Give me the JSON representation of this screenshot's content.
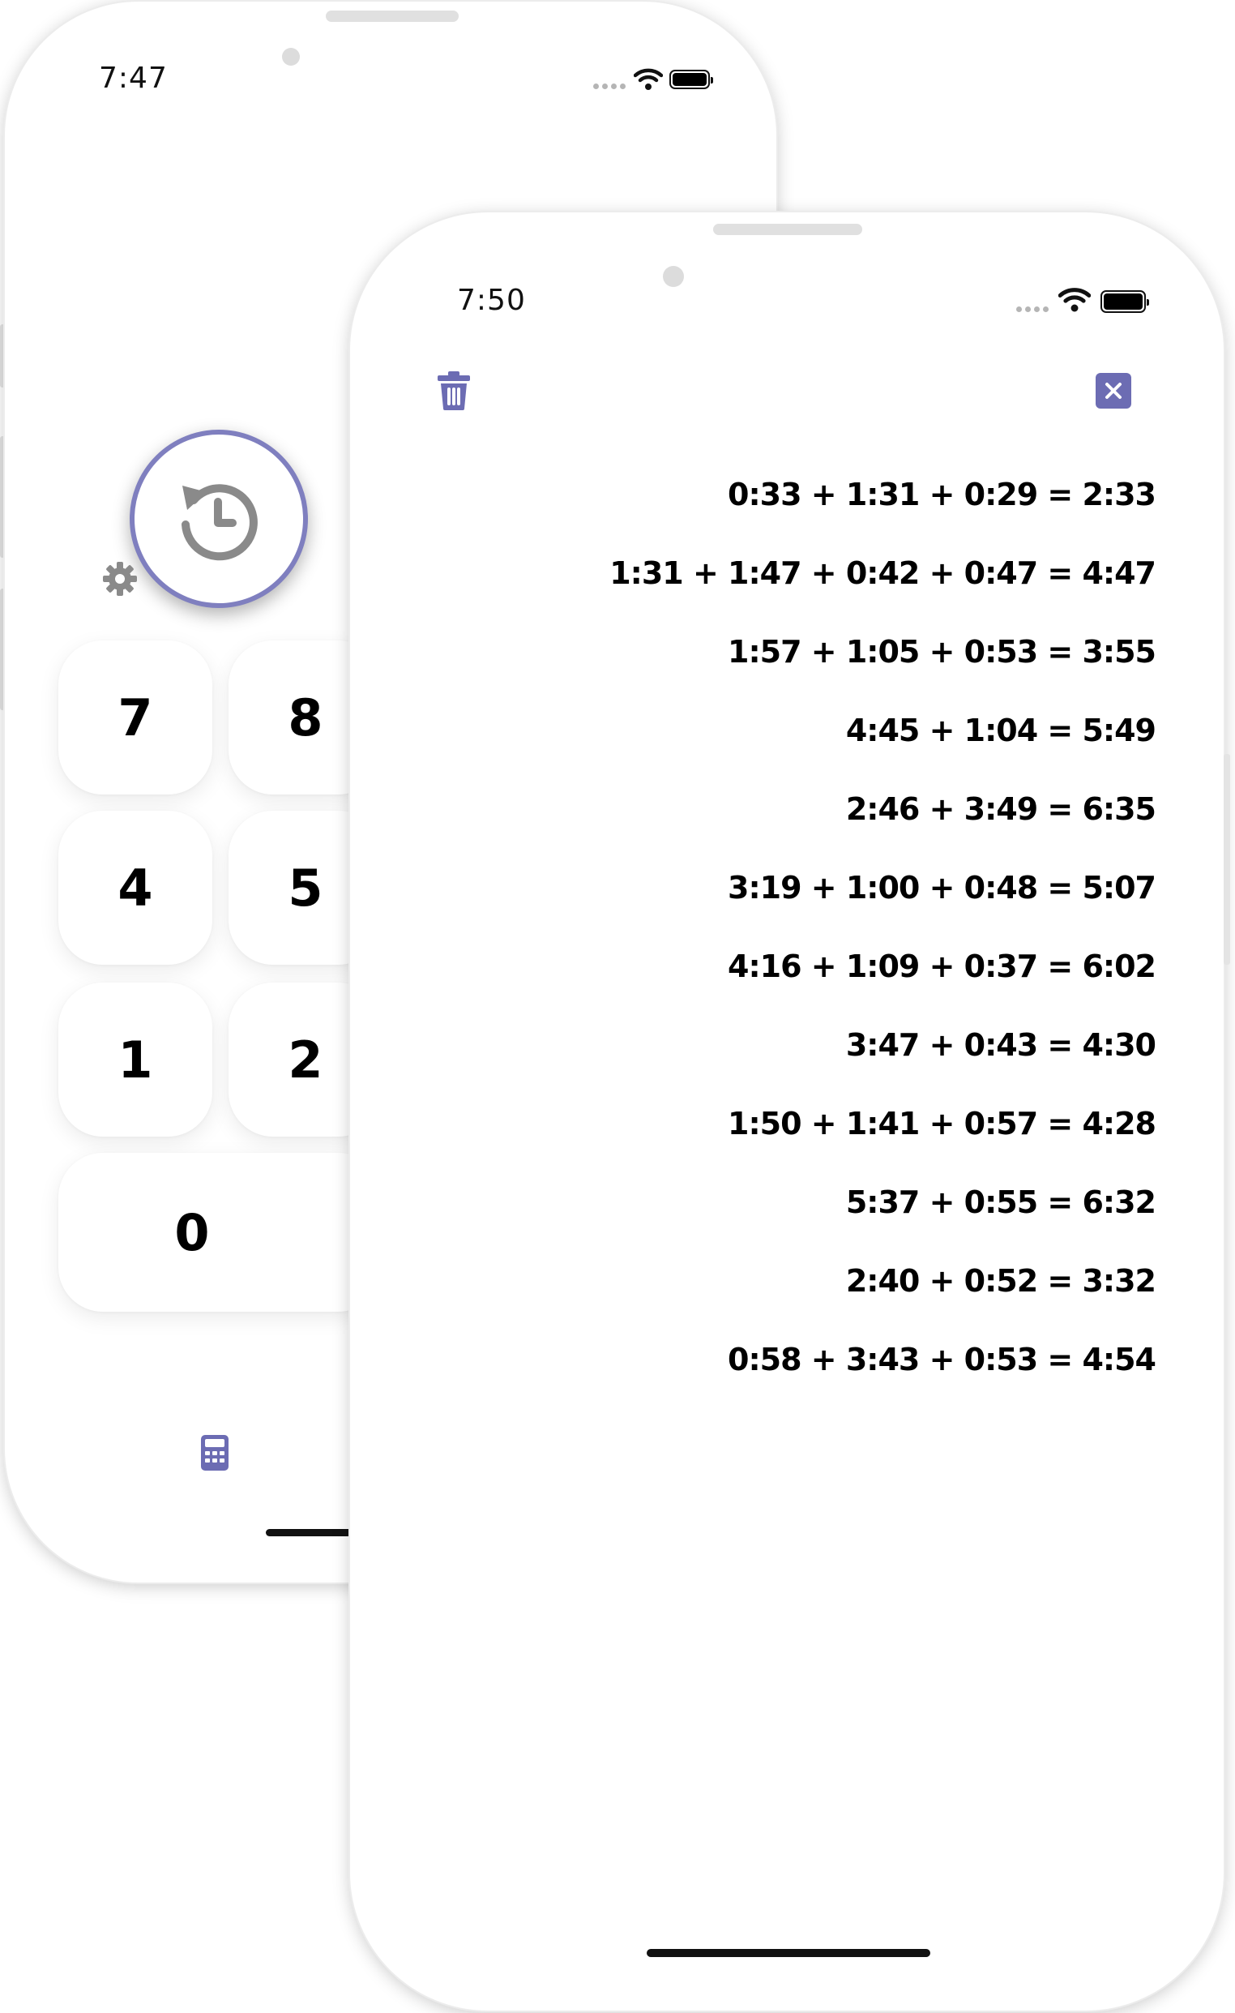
{
  "back_screen": {
    "status_time": "7:47",
    "keypad": [
      "7",
      "8",
      "4",
      "5",
      "1",
      "2",
      "0"
    ],
    "icons": {
      "history": "history-icon",
      "settings": "gear-icon",
      "calculator": "calculator-icon"
    }
  },
  "front_screen": {
    "status_time": "7:50",
    "icons": {
      "delete": "trash-icon",
      "close": "close-icon"
    },
    "history": [
      "0:33 + 1:31 + 0:29 = 2:33",
      "1:31 + 1:47 + 0:42 + 0:47 = 4:47",
      "1:57 + 1:05 + 0:53 = 3:55",
      "4:45 + 1:04 = 5:49",
      "2:46 + 3:49 = 6:35",
      "3:19 + 1:00 + 0:48 = 5:07",
      "4:16 + 1:09 + 0:37 = 6:02",
      "3:47 + 0:43 = 4:30",
      "1:50 + 1:41 + 0:57 = 4:28",
      "5:37 + 0:55 = 6:32",
      "2:40 + 0:52 = 3:32",
      "0:58 + 3:43 + 0:53 = 4:54"
    ]
  },
  "colors": {
    "accent": "#6c6cb3",
    "ring": "#7f7fbf",
    "icon_gray": "#8a8a8a",
    "text": "#000000"
  }
}
